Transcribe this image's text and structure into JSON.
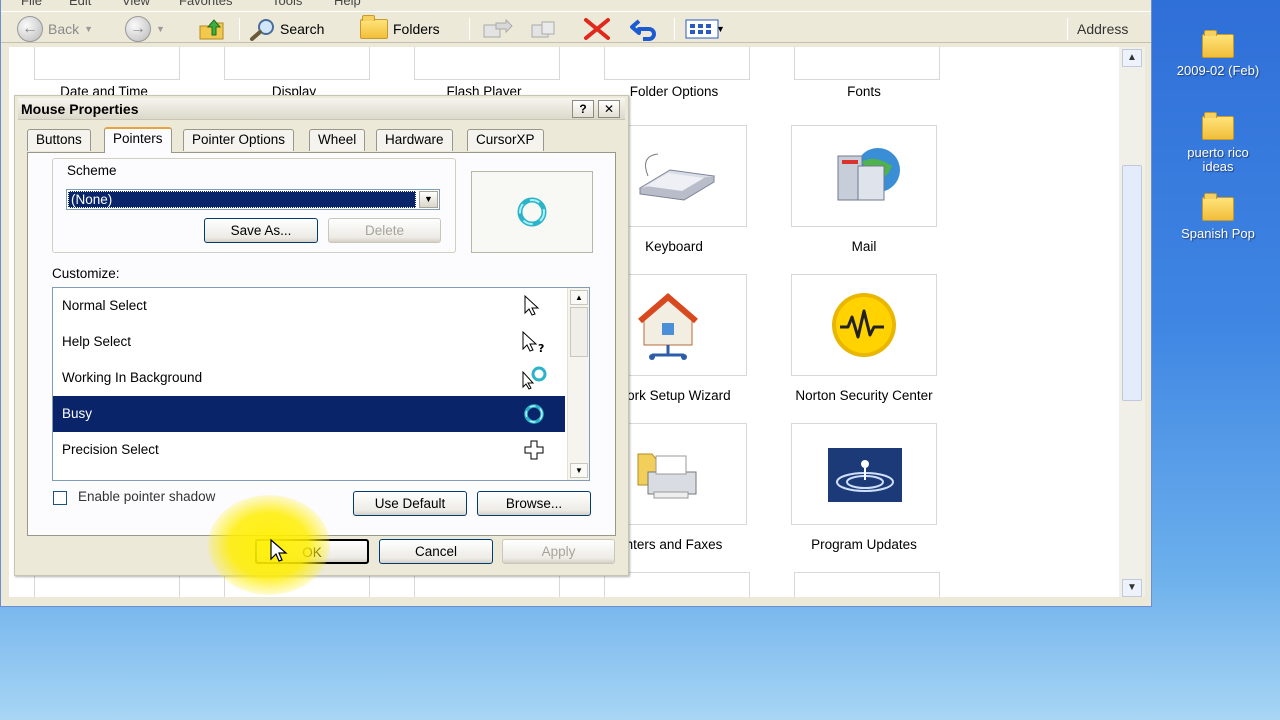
{
  "explorer": {
    "menu": [
      "File",
      "Edit",
      "View",
      "Favorites",
      "Tools",
      "Help"
    ],
    "toolbar": {
      "back": "Back",
      "search": "Search",
      "folders": "Folders",
      "address": "Address"
    },
    "top_row_labels": [
      "Date and Time",
      "Display",
      "Flash Player",
      "Folder Options",
      "Fonts"
    ],
    "items": [
      {
        "label": "Keyboard",
        "icon": "keyboard-icon"
      },
      {
        "label": "Mail",
        "icon": "mail-icon"
      },
      {
        "label": "work Setup Wizard",
        "icon": "network-setup-icon"
      },
      {
        "label": "Norton Security Center",
        "icon": "norton-icon"
      },
      {
        "label": "nters and Faxes",
        "icon": "printers-icon"
      },
      {
        "label": "Program Updates",
        "icon": "program-updates-icon"
      }
    ]
  },
  "dialog": {
    "title": "Mouse Properties",
    "help": "?",
    "close": "✕",
    "tabs": [
      "Buttons",
      "Pointers",
      "Pointer Options",
      "Wheel",
      "Hardware",
      "CursorXP"
    ],
    "active_tab": "Pointers",
    "scheme": {
      "legend": "Scheme",
      "selected": "(None)",
      "save_as": "Save As...",
      "delete": "Delete"
    },
    "customize_label": "Customize:",
    "cursors": [
      {
        "label": "Normal Select",
        "icon": "arrow-cursor-icon"
      },
      {
        "label": "Help Select",
        "icon": "help-cursor-icon"
      },
      {
        "label": "Working In Background",
        "icon": "working-cursor-icon"
      },
      {
        "label": "Busy",
        "icon": "busy-cursor-icon",
        "selected": true
      },
      {
        "label": "Precision Select",
        "icon": "precision-cursor-icon"
      }
    ],
    "enable_shadow": "Enable pointer shadow",
    "enable_shadow_checked": false,
    "use_default": "Use Default",
    "browse": "Browse...",
    "ok": "OK",
    "cancel": "Cancel",
    "apply": "Apply"
  },
  "desktop": {
    "icons": [
      "2009-02 (Feb)",
      "puerto rico ideas",
      "Spanish Pop"
    ]
  },
  "colors": {
    "selection": "#0a246a",
    "tab_accent": "#e6a33f",
    "highlight": "#fff000",
    "desktop": "#3f86e3"
  }
}
